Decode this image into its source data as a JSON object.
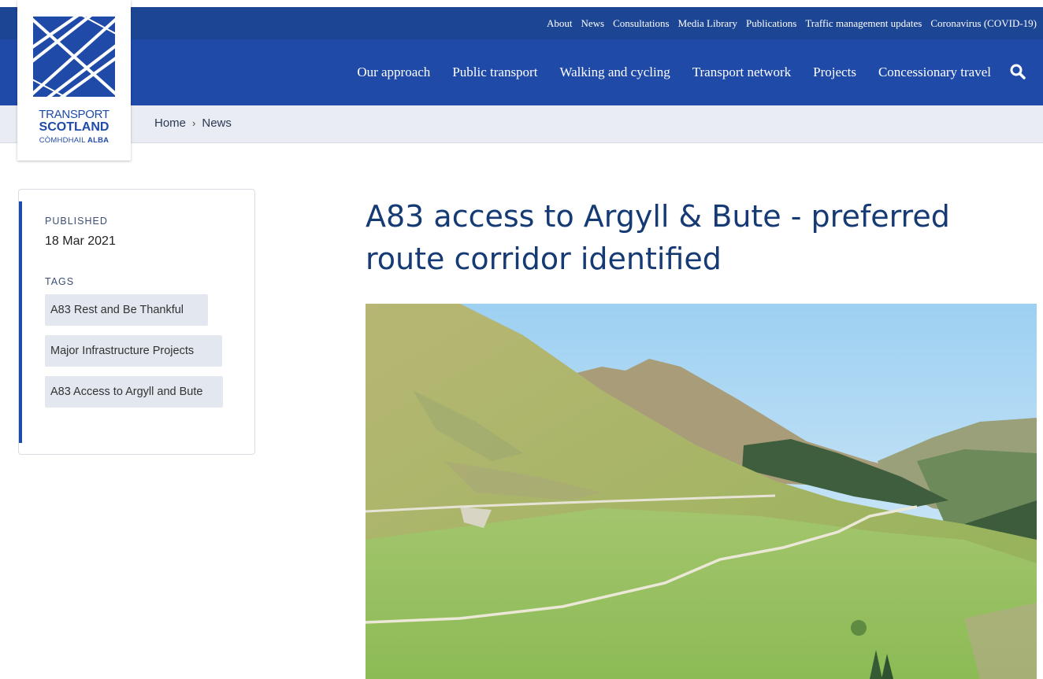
{
  "site": {
    "logo": {
      "line1": "TRANSPORT",
      "line2": "SCOTLAND",
      "line3_a": "CÒMHDHAIL",
      "line3_b": "ALBA"
    },
    "brand_color": "#1f4aa8",
    "utility_nav": [
      "About",
      "News",
      "Consultations",
      "Media Library",
      "Publications",
      "Traffic management updates",
      "Coronavirus (COVID-19)"
    ],
    "main_nav": [
      "Our approach",
      "Public transport",
      "Walking and cycling",
      "Transport network",
      "Projects",
      "Concessionary travel"
    ],
    "search_icon": "search-icon"
  },
  "breadcrumb": {
    "home": "Home",
    "separator": "›",
    "current": "News"
  },
  "meta": {
    "published_label": "PUBLISHED",
    "published_date": "18 Mar 2021",
    "tags_label": "TAGS",
    "tags": [
      "A83 Rest and Be Thankful",
      "Major Infrastructure Projects",
      "A83 Access to Argyll and Bute"
    ]
  },
  "article": {
    "title": "A83 access to Argyll & Bute - preferred route corridor identified",
    "image_icon": "glen-valley-photo"
  }
}
